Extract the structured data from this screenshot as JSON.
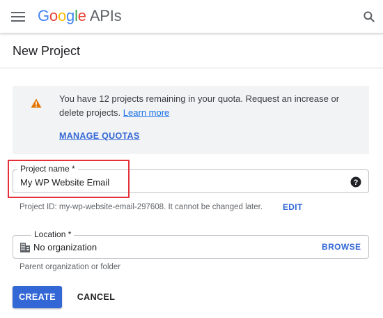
{
  "header": {
    "logo_letters": [
      "G",
      "o",
      "o",
      "g",
      "l",
      "e"
    ],
    "logo_product": "APIs",
    "menu_icon": "hamburger-menu-icon",
    "search_icon": "search-icon"
  },
  "page": {
    "title": "New Project"
  },
  "quota_notice": {
    "icon": "warning-icon",
    "icon_color": "#e37400",
    "text": "You have 12 projects remaining in your quota. Request an increase or delete projects.",
    "learn_more": "Learn more",
    "manage_quotas": "MANAGE QUOTAS"
  },
  "project_name": {
    "label": "Project name *",
    "value": "My WP Website Email",
    "help_icon": "help-circle-icon",
    "project_id_text": "Project ID: my-wp-website-email-297608. It cannot be changed later.",
    "edit_label": "EDIT"
  },
  "location": {
    "label": "Location *",
    "value": "No organization",
    "icon": "building-icon",
    "browse_label": "BROWSE",
    "helper": "Parent organization or folder"
  },
  "actions": {
    "create": "CREATE",
    "cancel": "CANCEL"
  },
  "colors": {
    "primary": "#3367d6",
    "highlight": "#e5303a"
  }
}
